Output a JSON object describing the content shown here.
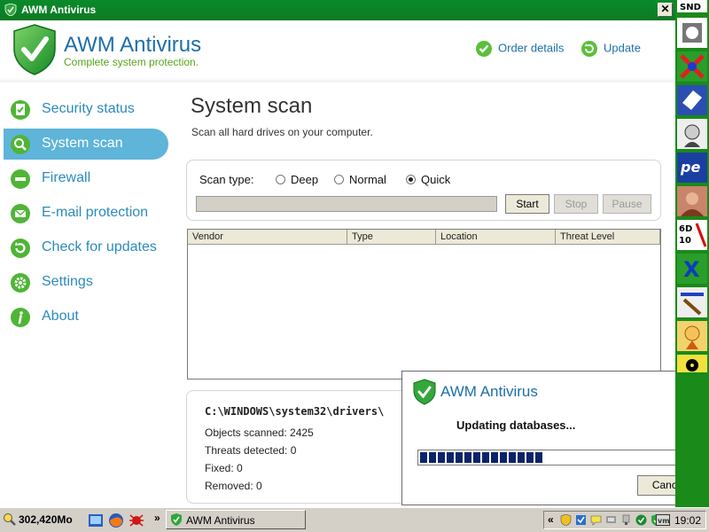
{
  "window": {
    "title": "AWM Antivirus",
    "close_glyph": "✕"
  },
  "header": {
    "app_name": "AWM Antivirus",
    "tagline": "Complete system protection.",
    "order_details": "Order details",
    "update": "Update"
  },
  "sidebar": {
    "items": [
      {
        "label": "Security status",
        "icon": "clipboard-check-icon"
      },
      {
        "label": "System scan",
        "icon": "magnifier-icon",
        "active": true
      },
      {
        "label": "Firewall",
        "icon": "wall-icon"
      },
      {
        "label": "E-mail protection",
        "icon": "envelope-icon"
      },
      {
        "label": "Check for updates",
        "icon": "refresh-icon"
      },
      {
        "label": "Settings",
        "icon": "gear-icon"
      },
      {
        "label": "About",
        "icon": "info-icon"
      }
    ]
  },
  "main": {
    "title": "System scan",
    "subtitle": "Scan all hard drives on your computer.",
    "scan_type_label": "Scan type:",
    "scan_types": [
      "Deep",
      "Normal",
      "Quick"
    ],
    "selected_scan_type": "Quick",
    "buttons": {
      "start": "Start",
      "stop": "Stop",
      "pause": "Pause"
    },
    "columns": [
      "Vendor",
      "Type",
      "Location",
      "Threat Level"
    ],
    "current_path": "C:\\WINDOWS\\system32\\drivers\\",
    "stats": {
      "objects_scanned": "Objects scanned: 2425",
      "threats_detected": "Threats detected: 0",
      "fixed": "Fixed: 0",
      "removed": "Removed: 0"
    }
  },
  "popup": {
    "title": "AWM Antivirus",
    "message": "Updating databases...",
    "progress": 0.45,
    "cancel": "Cancel"
  },
  "taskbar": {
    "disk_free": "302,420Mo",
    "chevron": "»",
    "task_label": "AWM Antivirus",
    "tray_chevron": "«",
    "clock": "19:02"
  },
  "colors": {
    "accent_blue": "#1e6fa8",
    "tagline_green": "#58a51a",
    "nav_active": "#5fb4d9",
    "titlebar": "#0a8a2a",
    "progress_fill": "#0a246a"
  }
}
